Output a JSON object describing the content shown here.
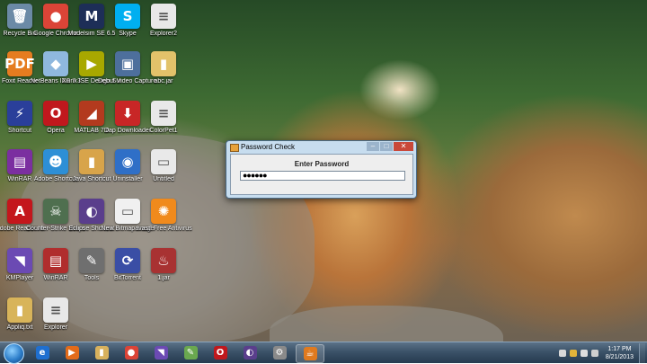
{
  "desktop_icons": [
    {
      "label": "Recycle Bin",
      "glyph": "🗑",
      "color": "#6b8aa6",
      "icon": "recycle-bin-icon"
    },
    {
      "label": "Google Chrome",
      "glyph": "●",
      "color": "#db4437",
      "icon": "chrome-icon"
    },
    {
      "label": "Modelsim SE 6.5",
      "glyph": "M",
      "color": "#1d2e57",
      "icon": "modelsim-icon"
    },
    {
      "label": "Skype",
      "glyph": "S",
      "color": "#00aff0",
      "icon": "skype-icon"
    },
    {
      "label": "Explorer2",
      "glyph": "≡",
      "color": "#e8e8e8",
      "icon": "text-file-icon"
    },
    {
      "label": "Foxit Reader",
      "glyph": "PDF",
      "color": "#e57c20",
      "icon": "pdf-icon"
    },
    {
      "label": "NetBeans IDE 7.3",
      "glyph": "◆",
      "color": "#8fb8de",
      "icon": "netbeans-icon"
    },
    {
      "label": "Xilinx ISE Design Sui...",
      "glyph": "▶",
      "color": "#a8a800",
      "icon": "xilinx-icon"
    },
    {
      "label": "Debut Video Capture S...",
      "glyph": "▣",
      "color": "#4d6f9c",
      "icon": "video-capture-icon"
    },
    {
      "label": "abc.jar",
      "glyph": "▮",
      "color": "#e2c26a",
      "icon": "folder-icon"
    },
    {
      "label": "Shortcut",
      "glyph": "⚡",
      "color": "#2a3f9a",
      "icon": "shortcut-icon"
    },
    {
      "label": "Opera",
      "glyph": "O",
      "color": "#c0181d",
      "icon": "opera-icon"
    },
    {
      "label": "MATLAB 7.0",
      "glyph": "◢",
      "color": "#b33a1e",
      "icon": "matlab-icon"
    },
    {
      "label": "Dap Downloader",
      "glyph": "⬇",
      "color": "#c82626",
      "icon": "downloader-icon"
    },
    {
      "label": "ColorPet1",
      "glyph": "≡",
      "color": "#e8e8e8",
      "icon": "text-file-icon"
    },
    {
      "label": "WinRAR",
      "glyph": "▤",
      "color": "#7b2fa0",
      "icon": "winrar-icon"
    },
    {
      "label": "Adobe Shortcut",
      "glyph": "☻",
      "color": "#2d8fd6",
      "icon": "shortcut-icon"
    },
    {
      "label": "Java Shortcut",
      "glyph": "▮",
      "color": "#d8a44a",
      "icon": "folder-icon"
    },
    {
      "label": "Uninstaller",
      "glyph": "◉",
      "color": "#2f6fc7",
      "icon": "uninstaller-icon"
    },
    {
      "label": "Untitled",
      "glyph": "▭",
      "color": "#e9e9e9",
      "icon": "image-file-icon"
    },
    {
      "label": "Adobe Reader XI",
      "glyph": "A",
      "color": "#c4161c",
      "icon": "adobe-reader-icon"
    },
    {
      "label": "Counter-Strike Source",
      "glyph": "☠",
      "color": "#4f6f4f",
      "icon": "game-icon"
    },
    {
      "label": "Eclipse Shortcut",
      "glyph": "◐",
      "color": "#5a3e8c",
      "icon": "eclipse-icon"
    },
    {
      "label": "New Bitmap Image",
      "glyph": "▭",
      "color": "#f0f0f0",
      "icon": "bitmap-icon"
    },
    {
      "label": "avast! Free Antivirus",
      "glyph": "✺",
      "color": "#f08a1c",
      "icon": "avast-icon"
    },
    {
      "label": "KMPlayer",
      "glyph": "◥",
      "color": "#6b4ab3",
      "icon": "kmplayer-icon"
    },
    {
      "label": "WinRAR",
      "glyph": "▤",
      "color": "#b02d2d",
      "icon": "winrar-icon"
    },
    {
      "label": "Tools",
      "glyph": "✎",
      "color": "#6f6f6f",
      "icon": "tools-icon"
    },
    {
      "label": "BitTorrent",
      "glyph": "⟳",
      "color": "#3a4ea5",
      "icon": "bittorrent-icon"
    },
    {
      "label": "1.jar",
      "glyph": "♨",
      "color": "#a83232",
      "icon": "java-icon"
    },
    {
      "label": "Appliq.txt",
      "glyph": "▮",
      "color": "#d8b45a",
      "icon": "folder-icon"
    },
    {
      "label": "Explorer",
      "glyph": "≡",
      "color": "#e8e8e8",
      "icon": "text-file-icon"
    }
  ],
  "dialog": {
    "title": "Password Check",
    "prompt": "Enter Password",
    "password_mask": "●●●●●●",
    "minimize": "–",
    "maximize": "□",
    "close": "✕"
  },
  "taskbar": {
    "apps": [
      {
        "glyph": "e",
        "color": "#1f6fd0",
        "icon": "internet-explorer-icon"
      },
      {
        "glyph": "▶",
        "color": "#e26b1a",
        "icon": "media-player-icon"
      },
      {
        "glyph": "▮",
        "color": "#d7b15d",
        "icon": "file-explorer-icon"
      },
      {
        "glyph": "●",
        "color": "#db4437",
        "icon": "chrome-icon"
      },
      {
        "glyph": "◥",
        "color": "#6b4ab3",
        "icon": "kmplayer-icon"
      },
      {
        "glyph": "✎",
        "color": "#6aa84f",
        "icon": "tools-icon"
      },
      {
        "glyph": "O",
        "color": "#c0181d",
        "icon": "opera-icon"
      },
      {
        "glyph": "◐",
        "color": "#5a3e8c",
        "icon": "eclipse-icon"
      },
      {
        "glyph": "⚙",
        "color": "#8a8a8a",
        "icon": "netbeans-icon"
      },
      {
        "glyph": "☕",
        "color": "#e07a1f",
        "icon": "java-icon"
      }
    ],
    "clock_time": "1:17 PM",
    "clock_date": "8/21/2013"
  }
}
